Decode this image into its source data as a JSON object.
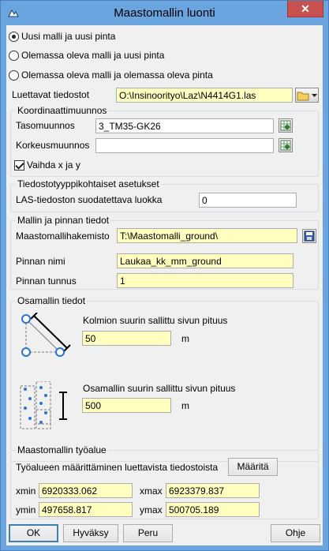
{
  "window": {
    "title": "Maastomallin luonti",
    "close_label": "✕"
  },
  "mode_options": [
    {
      "label": "Uusi malli ja uusi pinta",
      "selected": true
    },
    {
      "label": "Olemassa oleva malli ja uusi pinta",
      "selected": false
    },
    {
      "label": "Olemassa oleva malli ja olemassa oleva pinta",
      "selected": false
    }
  ],
  "input_files": {
    "label": "Luettavat tiedostot",
    "value": "O:\\Insinoorityo\\Laz\\N4414G1.las"
  },
  "coordinate_transform": {
    "title": "Koordinaattimuunnos",
    "planar_label": "Tasomuunnos",
    "planar_value": "3_TM35-GK26",
    "height_label": "Korkeusmuunnos",
    "height_value": "",
    "swap_xy_label": "Vaihda x ja y",
    "swap_xy_checked": true
  },
  "filetype_settings": {
    "title": "Tiedostotyyppikohtaiset asetukset",
    "las_filter_label": "LAS-tiedoston suodatettava luokka",
    "las_filter_value": "0"
  },
  "model_surface": {
    "title": "Mallin ja pinnan tiedot",
    "dir_label": "Maastomallihakemisto",
    "dir_value": "T:\\Maastomalli_ground\\",
    "surface_name_label": "Pinnan nimi",
    "surface_name_value": "Laukaa_kk_mm_ground",
    "surface_id_label": "Pinnan tunnus",
    "surface_id_value": "1"
  },
  "submodel": {
    "title": "Osamallin tiedot",
    "triangle_label": "Kolmion suurin sallittu sivun pituus",
    "triangle_value": "50",
    "triangle_unit": "m",
    "submodel_label": "Osamallin suurin sallittu sivun pituus",
    "submodel_value": "500",
    "submodel_unit": "m"
  },
  "work_area": {
    "title": "Maastomallin työalue",
    "define_label": "Työalueen määrittäminen luettavista tiedostoista",
    "define_button": "Määritä",
    "xmin_label": "xmin",
    "xmin_value": "6920333.062",
    "xmax_label": "xmax",
    "xmax_value": "6923379.837",
    "ymin_label": "ymin",
    "ymin_value": "497658.817",
    "ymax_label": "ymax",
    "ymax_value": "500705.189"
  },
  "buttons": {
    "ok": "OK",
    "accept": "Hyväksy",
    "cancel": "Peru",
    "help": "Ohje"
  }
}
